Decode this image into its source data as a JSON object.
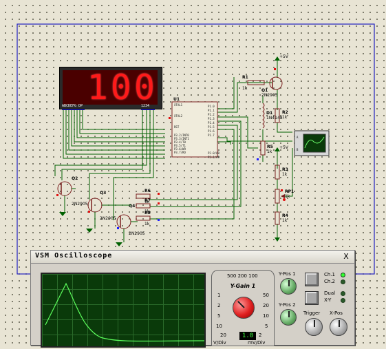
{
  "display": {
    "digits": "100",
    "ghost_digits": "88",
    "pin_labels_left": "ABCDEFG DP",
    "pin_labels_right": "1234"
  },
  "components": {
    "u1": "U1",
    "r1": "R1",
    "r1v": "1k",
    "q1": "Q1",
    "q1v": "2N2905",
    "r2": "R2",
    "r2v": "1k",
    "d1": "D1",
    "d1v": "1N4148",
    "r5": "R5",
    "r5v": "1k",
    "r3": "R3",
    "r3v": "1k",
    "rp1": "RP1",
    "rp1v": "1k",
    "r4": "R4",
    "r4v": "1k",
    "q2": "Q2",
    "q2v": "2N2905",
    "q3": "Q3",
    "q3v": "2N2905",
    "q4": "Q4",
    "q4v": "2N2905",
    "r6": "R6",
    "r6v": "1k",
    "r7": "R7",
    "r7v": "1k",
    "r8": "R8",
    "r8v": "1k",
    "vcc1": "+5V",
    "vcc2": "+5V"
  },
  "u1_pins_left": [
    "XTAL1",
    "XTAL2",
    "RST",
    "P3.2/INT0",
    "P3.3/INT1",
    "P3.4/T0",
    "P3.5/T1",
    "P3.6/WR",
    "P3.7/RD"
  ],
  "u1_pins_right": [
    "P1.0",
    "P1.1",
    "P1.2",
    "P1.3",
    "P1.4",
    "P1.5",
    "P1.6",
    "P1.7",
    "P2.0/A8",
    "P2.1/A9"
  ],
  "oscilloscope": {
    "title": "VSM Oscilloscope",
    "close": "X",
    "ygain": {
      "title": "Y-Gain 1",
      "top_scale": "500 200 100",
      "left_scale": [
        "1",
        "2",
        "5",
        "10",
        "20"
      ],
      "right_scale": [
        "50",
        "20",
        "10",
        "5",
        "2"
      ],
      "unit_left": "V/Div",
      "unit_right": "mV/Div",
      "value": "1.0"
    },
    "ypos1": "Y-Pos 1",
    "ypos2": "Y-Pos 2",
    "trigger": "Trigger",
    "xpos": "X-Pos",
    "ch1": "Ch.1",
    "ch2": "Ch.2",
    "dual": "Dual",
    "xy": "X-Y",
    "colors": {
      "trace": "#5cff5c",
      "screen": "#0a3a0a",
      "wire": "#006000"
    }
  }
}
